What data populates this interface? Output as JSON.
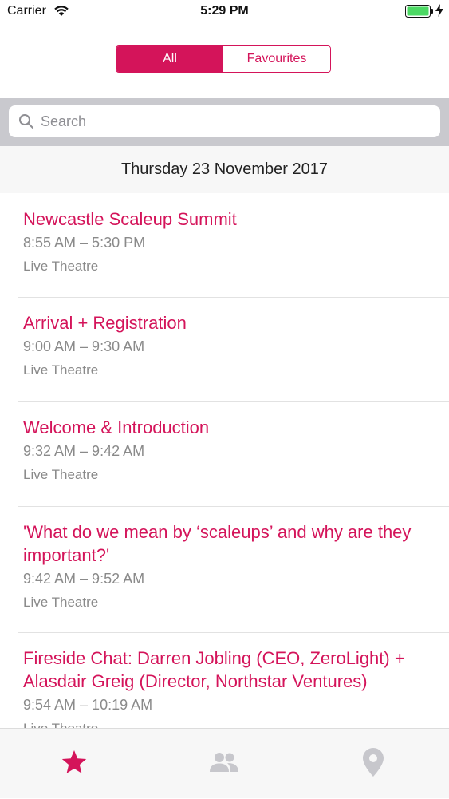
{
  "status_bar": {
    "carrier": "Carrier",
    "time": "5:29 PM"
  },
  "segmented_control": {
    "all_label": "All",
    "favourites_label": "Favourites",
    "selected": "All"
  },
  "search": {
    "placeholder": "Search",
    "value": ""
  },
  "section": {
    "date_header": "Thursday 23 November 2017"
  },
  "events": [
    {
      "title": "Newcastle Scaleup Summit",
      "time": "8:55 AM – 5:30 PM",
      "venue": "Live Theatre"
    },
    {
      "title": "Arrival + Registration",
      "time": "9:00 AM – 9:30 AM",
      "venue": "Live Theatre"
    },
    {
      "title": "Welcome & Introduction",
      "time": "9:32 AM – 9:42 AM",
      "venue": "Live Theatre"
    },
    {
      "title": "'What do we mean by ‘scaleups’ and why are they important?'",
      "time": "9:42 AM – 9:52 AM",
      "venue": "Live Theatre"
    },
    {
      "title": "Fireside Chat: Darren Jobling (CEO, ZeroLight) + Alasdair Greig (Director, Northstar Ventures)",
      "time": "9:54 AM – 10:19 AM",
      "venue": "Live Theatre"
    }
  ],
  "tab_bar": {
    "tabs": [
      {
        "icon": "star-icon",
        "active": true
      },
      {
        "icon": "people-icon",
        "active": false
      },
      {
        "icon": "location-pin-icon",
        "active": false
      }
    ]
  },
  "colors": {
    "accent": "#d4145a",
    "secondary_text": "#8a8a8a",
    "inactive_icon": "#c7c7cc"
  }
}
